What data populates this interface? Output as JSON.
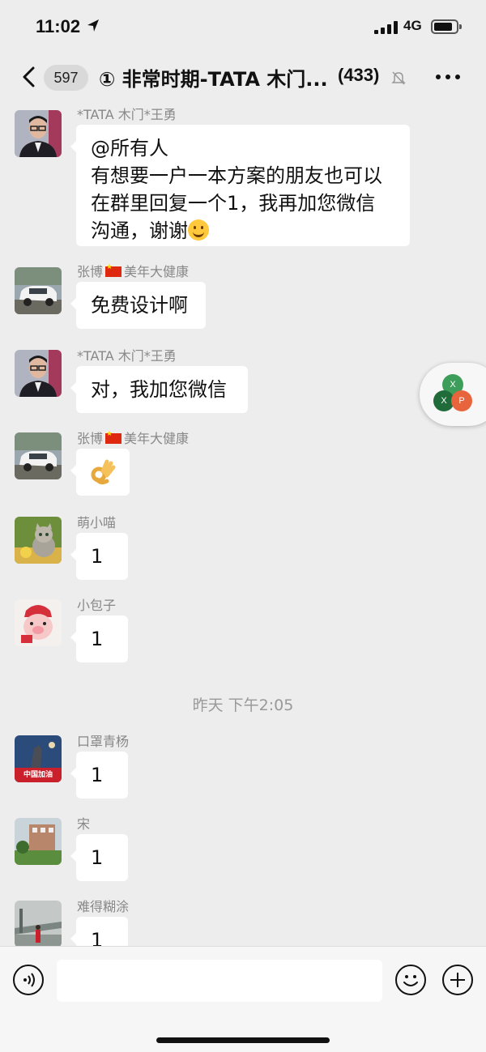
{
  "status_bar": {
    "time": "11:02",
    "network": "4G"
  },
  "nav": {
    "unread_count": "597",
    "group_title": "① 非常时期-TATA 木门...",
    "member_count": "(433)"
  },
  "messages": [
    {
      "sender": "*TATA 木门*王勇",
      "lines": [
        "@所有人",
        "有想要一户一本方案的朋友也可以",
        "在群里回复一个1，我再加您微信",
        "沟通，谢谢"
      ]
    },
    {
      "sender_name": "张博",
      "sender_suffix": "美年大健康",
      "text": "免费设计啊"
    },
    {
      "sender": "*TATA 木门*王勇",
      "text": "对，我加您微信"
    },
    {
      "sender_name": "张博",
      "sender_suffix": "美年大健康",
      "emoji": "ok-hand"
    },
    {
      "sender": "萌小喵",
      "text": "1"
    },
    {
      "sender": "小包子",
      "text": "1"
    },
    {
      "sender": "口罩青杨",
      "text": "1",
      "avatar_text": "中国加油"
    },
    {
      "sender": "宋",
      "text": "1"
    },
    {
      "sender": "难得糊涂",
      "text": "1"
    }
  ],
  "timestamp": "昨天 下午2:05",
  "floating_widget": {
    "letters": [
      "X",
      "X",
      "P"
    ],
    "colors": [
      "#3d9d5a",
      "#1f6b3a",
      "#e8643c"
    ]
  },
  "icons": {
    "back": "chevron-left-icon",
    "mute": "bell-slash-icon",
    "more": "more-dots-icon",
    "voice": "voice-icon",
    "emoji": "emoji-icon",
    "add": "plus-icon"
  },
  "colors": {
    "background": "#ededed",
    "bubble": "#ffffff",
    "input_bar": "#f6f6f6"
  }
}
